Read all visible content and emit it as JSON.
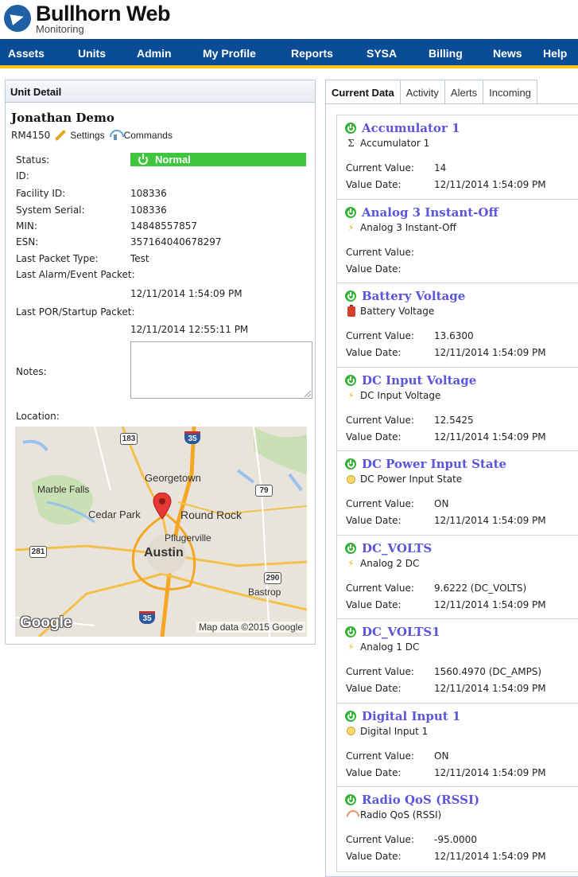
{
  "header": {
    "logo_title": "Bullhorn Web",
    "logo_subtitle": "Monitoring"
  },
  "nav": {
    "items": [
      "Assets",
      "Units",
      "Admin",
      "My Profile",
      "Reports",
      "SYSA",
      "Billing",
      "News",
      "Help"
    ]
  },
  "unit_detail": {
    "panel_title": "Unit Detail",
    "unit_name": "Jonathan Demo",
    "model": "RM4150",
    "settings_label": "Settings",
    "commands_label": "Commands",
    "fields": {
      "status_label": "Status:",
      "status_value": "Normal",
      "id_label": "ID:",
      "id_value": "",
      "facility_label": "Facility ID:",
      "facility_value": "108336",
      "serial_label": "System Serial:",
      "serial_value": "108336",
      "min_label": "MIN:",
      "min_value": "14848557857",
      "esn_label": "ESN:",
      "esn_value": "357164040678297",
      "packet_type_label": "Last Packet Type:",
      "packet_type_value": "Test",
      "alarm_label": "Last Alarm/Event Packet:",
      "alarm_value": "12/11/2014 1:54:09 PM",
      "por_label": "Last POR/Startup Packet:",
      "por_value": "12/11/2014 12:55:11 PM",
      "notes_label": "Notes:",
      "notes_value": "",
      "location_label": "Location:"
    },
    "map": {
      "places": [
        "Georgetown",
        "Marble Falls",
        "Cedar Park",
        "Round Rock",
        "Pflugerville",
        "Austin",
        "Bastrop"
      ],
      "shields": [
        "183",
        "35",
        "79",
        "281",
        "290",
        "35"
      ],
      "google": "Google",
      "attribution": "Map data ©2015 Google"
    }
  },
  "tabs": [
    "Current Data",
    "Activity",
    "Alerts",
    "Incoming"
  ],
  "data_labels": {
    "current_value": "Current Value:",
    "value_date": "Value Date:"
  },
  "cards": [
    {
      "title": "Accumulator 1",
      "subtitle": "Accumulator 1",
      "icon": "sigma-icon",
      "value": "14",
      "date": "12/11/2014 1:54:09 PM"
    },
    {
      "title": "Analog 3 Instant-Off",
      "subtitle": "Analog 3 Instant-Off",
      "icon": "lightning-icon",
      "value": "",
      "date": ""
    },
    {
      "title": "Battery Voltage",
      "subtitle": "Battery Voltage",
      "icon": "battery-icon",
      "value": "13.6300",
      "date": "12/11/2014 1:54:09 PM"
    },
    {
      "title": "DC Input Voltage",
      "subtitle": "DC Input Voltage",
      "icon": "lightning-icon",
      "value": "12.5425",
      "date": "12/11/2014 1:54:09 PM"
    },
    {
      "title": "DC Power Input State",
      "subtitle": "DC Power Input State",
      "icon": "lightbulb-icon",
      "value": "ON",
      "date": "12/11/2014 1:54:09 PM"
    },
    {
      "title": "DC_VOLTS",
      "subtitle": "Analog 2 DC",
      "icon": "lightning-icon",
      "value": "9.6222 (DC_VOLTS)",
      "date": "12/11/2014 1:54:09 PM"
    },
    {
      "title": "DC_VOLTS1",
      "subtitle": "Analog 1 DC",
      "icon": "lightning-icon",
      "value": "1560.4970 (DC_AMPS)",
      "date": "12/11/2014 1:54:09 PM"
    },
    {
      "title": "Digital Input 1",
      "subtitle": "Digital Input 1",
      "icon": "lightbulb-icon",
      "value": "ON",
      "date": "12/11/2014 1:54:09 PM"
    },
    {
      "title": "Radio QoS (RSSI)",
      "subtitle": "Radio QoS (RSSI)",
      "icon": "radio-signal-icon",
      "value": "-95.0000",
      "date": "12/11/2014 1:54:09 PM"
    }
  ],
  "colors": {
    "nav_bg": "#0a4d96",
    "nav_accent": "#f7c21a",
    "status_ok": "#3ec73e",
    "card_title": "#5a55d9",
    "power_icon": "#33b233"
  }
}
